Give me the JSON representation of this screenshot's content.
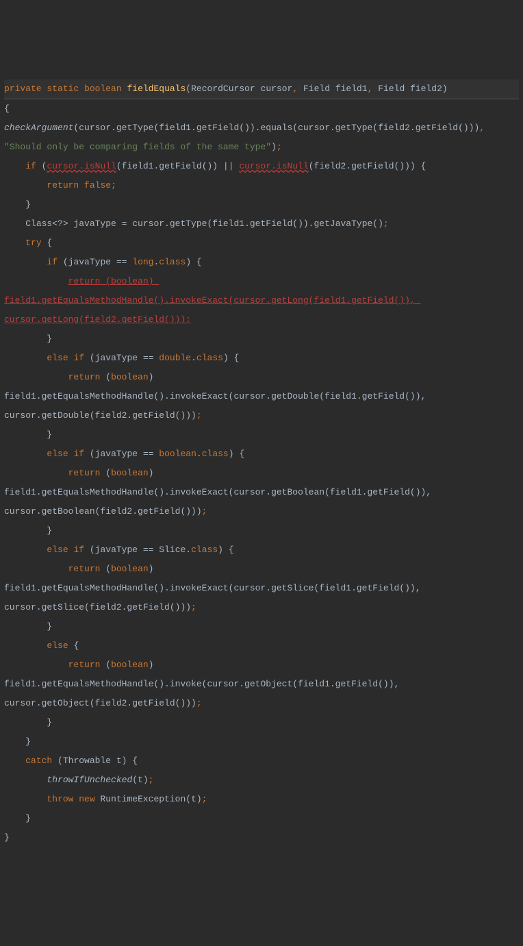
{
  "code": {
    "sig": {
      "private": "private",
      "static": "static",
      "boolean": "boolean",
      "name": "fieldEquals",
      "p1t": "RecordCursor",
      "p1n": "cursor",
      "p2t": "Field",
      "p2n": "field1",
      "p3t": "Field",
      "p3n": "field2"
    },
    "checkArg": "checkArgument",
    "checkExpr1": "(cursor.getType(field1.getField()).equals(cursor.getType(field2.getField()))",
    "checkStr": "\"Should only be comparing fields of the same type\"",
    "if": "if",
    "isNull1": "cursor.isNull",
    "isNullArg1": "(field1.getField()) || ",
    "isNull2": "cursor.isNull",
    "isNullArg2": "(field2.getField())) {",
    "return": "return",
    "false": "false",
    "classDecl": "Class<?> javaType = cursor.getType(field1.getField()).getJavaType()",
    "try": "try",
    "javaTypeEq": "(javaType == ",
    "long": "long",
    "dotClass": ".",
    "classKw": "class",
    "retBool": "return (boolean) ",
    "longInvoke1": "field1.getEqualsMethodHandle().invokeExact(cursor.getLong(field1.getField()), ",
    "longInvoke2": "cursor.getLong(field2.getField()));",
    "else": "else",
    "double": "double",
    "retParen": "return",
    "boolCast": "boolean",
    "dblInvoke1": "field1.getEqualsMethodHandle().invokeExact(cursor.getDouble(field1.getField()), ",
    "dblInvoke2": "cursor.getDouble(field2.getField()))",
    "booleanT": "boolean",
    "boolInvoke1": "field1.getEqualsMethodHandle().invokeExact(cursor.getBoolean(field1.getField()), ",
    "boolInvoke2": "cursor.getBoolean(field2.getField()))",
    "slice": "Slice.",
    "sliceInvoke1": "field1.getEqualsMethodHandle().invokeExact(cursor.getSlice(field1.getField()), ",
    "sliceInvoke2": "cursor.getSlice(field2.getField()))",
    "objInvoke1": "field1.getEqualsMethodHandle().invoke(cursor.getObject(field1.getField()), ",
    "objInvoke2": "cursor.getObject(field2.getField()))",
    "catch": "catch",
    "throwable": "(Throwable t) {",
    "throwIf": "throwIfUnchecked",
    "throwIfArg": "(t)",
    "throw": "throw",
    "new": "new",
    "runtime": "RuntimeException(t)"
  }
}
